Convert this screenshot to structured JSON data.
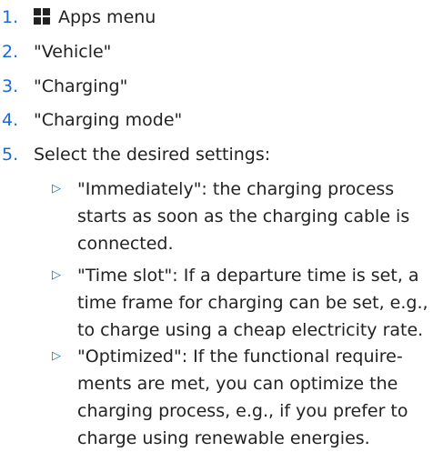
{
  "steps": [
    {
      "num": "1.",
      "label": "Apps menu",
      "icon": "apps-grid-icon"
    },
    {
      "num": "2.",
      "label": "\"Vehicle\""
    },
    {
      "num": "3.",
      "label": "\"Charging\""
    },
    {
      "num": "4.",
      "label": "\"Charging mode\""
    },
    {
      "num": "5.",
      "label": "Select the desired settings:"
    }
  ],
  "bullet_marker": "▷",
  "bullets": [
    {
      "lines": [
        "\"Immediately\": the charging process",
        "starts as soon as the charging cable is",
        "connected."
      ]
    },
    {
      "lines": [
        "\"Time slot\": If a departure time is set, a",
        "time frame for charging can be set, e.g.,",
        "to charge using a cheap electricity rate."
      ]
    },
    {
      "lines": [
        "\"Optimized\": If the functional require-",
        "ments are met, you can optimize the",
        "charging process, e.g., if you prefer to",
        "charge using renewable energies."
      ]
    }
  ],
  "colors": {
    "accent": "#1c69d4",
    "text": "#222222"
  }
}
